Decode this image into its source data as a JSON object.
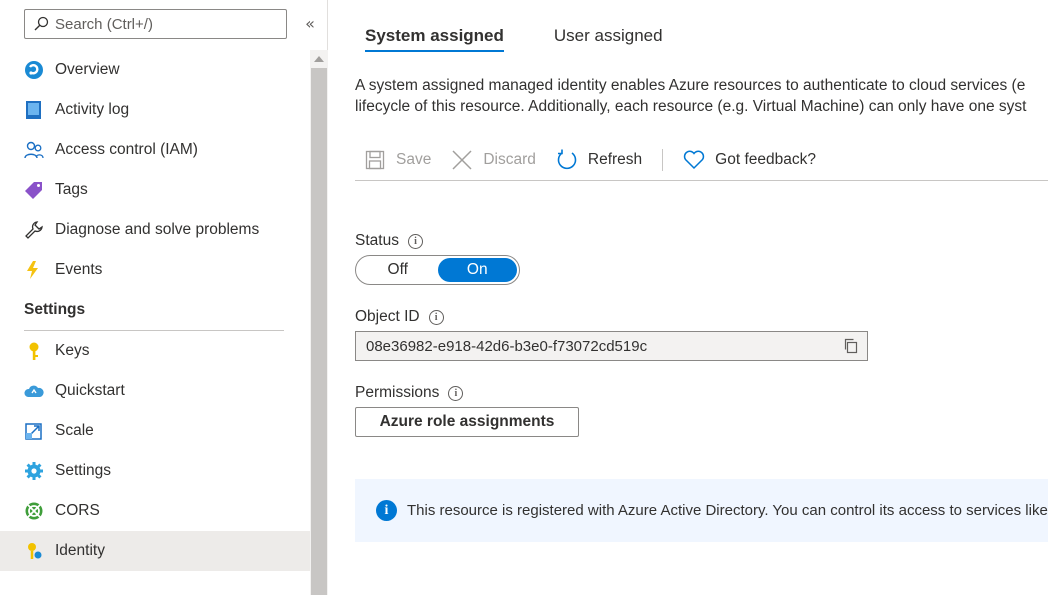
{
  "search": {
    "placeholder": "Search (Ctrl+/)"
  },
  "sidebar": {
    "collapse_label": "«",
    "items": [
      {
        "label": "Overview",
        "icon": "overview-icon"
      },
      {
        "label": "Activity log",
        "icon": "activity-log-icon"
      },
      {
        "label": "Access control (IAM)",
        "icon": "iam-icon"
      },
      {
        "label": "Tags",
        "icon": "tag-icon"
      },
      {
        "label": "Diagnose and solve problems",
        "icon": "wrench-icon"
      },
      {
        "label": "Events",
        "icon": "lightning-icon"
      }
    ],
    "settings_header": "Settings",
    "settings_items": [
      {
        "label": "Keys",
        "icon": "key-icon"
      },
      {
        "label": "Quickstart",
        "icon": "cloud-icon"
      },
      {
        "label": "Scale",
        "icon": "scale-icon"
      },
      {
        "label": "Settings",
        "icon": "gear-icon"
      },
      {
        "label": "CORS",
        "icon": "cors-icon"
      },
      {
        "label": "Identity",
        "icon": "identity-icon",
        "active": true
      }
    ]
  },
  "tabs": [
    {
      "label": "System assigned",
      "active": true
    },
    {
      "label": "User assigned",
      "active": false
    }
  ],
  "description": {
    "line1": "A system assigned managed identity enables Azure resources to authenticate to cloud services (e",
    "line2": "lifecycle of this resource. Additionally, each resource (e.g. Virtual Machine) can only have one syst"
  },
  "toolbar": {
    "save": "Save",
    "discard": "Discard",
    "refresh": "Refresh",
    "feedback": "Got feedback?"
  },
  "status": {
    "label": "Status",
    "off": "Off",
    "on": "On",
    "value": "On"
  },
  "object_id": {
    "label": "Object ID",
    "value": "08e36982-e918-42d6-b3e0-f73072cd519c"
  },
  "permissions": {
    "label": "Permissions",
    "button": "Azure role assignments"
  },
  "banner": {
    "text": "This resource is registered with Azure Active Directory. You can control its access to services like A"
  },
  "colors": {
    "accent": "#0078d4",
    "active_nav_bg": "#edebe9",
    "banner_bg": "#f0f6ff"
  }
}
